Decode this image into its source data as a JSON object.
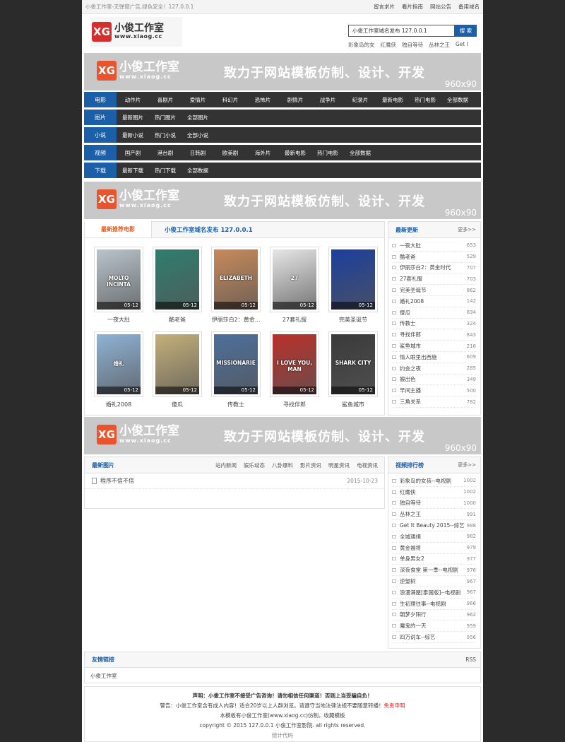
{
  "topbar": {
    "slogan": "小俊工作室-无弹窗广告,绿色安全！127.0.0.1",
    "links": [
      "留言求片",
      "看片指南",
      "网站公告",
      "备用域名"
    ]
  },
  "header": {
    "logo_cn": "小俊工作室",
    "logo_url": "www.xiaog.cc",
    "search_value": "小俊工作室域名发布 127.0.0.1",
    "search_button": "搜 索",
    "hotwords": [
      "彩象岛的女",
      "红鹰侠",
      "独自等待",
      "丛林之王",
      "Get I"
    ]
  },
  "banner": {
    "cn": "小俊工作室",
    "url": "www.xiaog.cc",
    "slogan": "致力于网站模板仿制、设计、开发",
    "size": "960x90"
  },
  "nav": [
    {
      "cat": "电影",
      "items": [
        "动作片",
        "喜剧片",
        "爱情片",
        "科幻片",
        "恐怖片",
        "剧情片",
        "战争片",
        "纪录片",
        "最新电影",
        "热门电影",
        "全部数据"
      ]
    },
    {
      "cat": "图片",
      "items": [
        "最新图片",
        "热门图片",
        "全部图片"
      ]
    },
    {
      "cat": "小说",
      "items": [
        "最新小说",
        "热门小说",
        "全部小说"
      ]
    },
    {
      "cat": "视频",
      "items": [
        "国产剧",
        "港台剧",
        "日韩剧",
        "欧美剧",
        "海外片",
        "最新电影",
        "热门电影",
        "全部数据"
      ]
    },
    {
      "cat": "下载",
      "items": [
        "最新下载",
        "热门下载",
        "全部数据"
      ]
    }
  ],
  "recommend": {
    "tab1": "最新推荐电影",
    "tab2": "小俊工作室域名发布 127.0.0.1",
    "posters": [
      {
        "title": "一夜大肚",
        "date": "05-12",
        "color": "#b8c4cc",
        "text": "MOLTO INCINTA"
      },
      {
        "title": "酷老爸",
        "date": "05-12",
        "color": "#2f7d6e",
        "text": ""
      },
      {
        "title": "伊丽莎白2：黄金...",
        "date": "05-12",
        "color": "#c88a5a",
        "text": "ELIZABETH"
      },
      {
        "title": "27套礼服",
        "date": "05-12",
        "color": "#e6e6e6",
        "text": "27"
      },
      {
        "title": "完美圣诞节",
        "date": "05-12",
        "color": "#1c3f9e",
        "text": ""
      },
      {
        "title": "婚礼2008",
        "date": "05-12",
        "color": "#8fb3d6",
        "text": "婚礼"
      },
      {
        "title": "傻瓜",
        "date": "05-12",
        "color": "#c4b07a",
        "text": ""
      },
      {
        "title": "传教士",
        "date": "05-12",
        "color": "#4d6f9c",
        "text": "MISSIONARIE"
      },
      {
        "title": "寻找伴郎",
        "date": "05-12",
        "color": "#b9302a",
        "text": "I LOVE YOU, MAN"
      },
      {
        "title": "鲨鱼城市",
        "date": "05-12",
        "color": "#3a3a3a",
        "text": "SHARK CITY"
      }
    ]
  },
  "latest": {
    "title": "最新更新",
    "more": "更多>>",
    "items": [
      {
        "name": "一夜大肚",
        "count": "653"
      },
      {
        "name": "酷老爸",
        "count": "529"
      },
      {
        "name": "伊丽莎白2：黄金时代",
        "count": "707"
      },
      {
        "name": "27套礼服",
        "count": "703"
      },
      {
        "name": "完美圣诞节",
        "count": "862"
      },
      {
        "name": "婚礼2008",
        "count": "142"
      },
      {
        "name": "傻瓜",
        "count": "834"
      },
      {
        "name": "传教士",
        "count": "324"
      },
      {
        "name": "寻找伴郎",
        "count": "843"
      },
      {
        "name": "鲨鱼城市",
        "count": "216"
      },
      {
        "name": "情人眼里出西施",
        "count": "609"
      },
      {
        "name": "约会之夜",
        "count": "285"
      },
      {
        "name": "搬出色",
        "count": "349"
      },
      {
        "name": "早间主播",
        "count": "500"
      },
      {
        "name": "三角关系",
        "count": "782"
      }
    ]
  },
  "news": {
    "title": "最新图片",
    "tabs": [
      "站内新闻",
      "娱乐动态",
      "八卦爆料",
      "影片资讯",
      "明星资讯",
      "电视资讯"
    ],
    "items": [
      {
        "title": "程序不信不信",
        "date": "2015-10-23"
      }
    ]
  },
  "ranking": {
    "title": "视频排行榜",
    "more": "更多>>",
    "items": [
      {
        "name": "彩象岛的女孩--电视剧",
        "count": "1002"
      },
      {
        "name": "红鹰侠",
        "count": "1002"
      },
      {
        "name": "独自等待",
        "count": "1000"
      },
      {
        "name": "丛林之王",
        "count": "991"
      },
      {
        "name": "Get It Beauty 2015--综艺",
        "count": "988"
      },
      {
        "name": "全城通缉",
        "count": "982"
      },
      {
        "name": "黄金福将",
        "count": "979"
      },
      {
        "name": "单身男女2",
        "count": "977"
      },
      {
        "name": "深夜食堂 第一季--电视剧",
        "count": "976"
      },
      {
        "name": "逆望树",
        "count": "967"
      },
      {
        "name": "浪漫满屋[泰国版]--电视剧",
        "count": "967"
      },
      {
        "name": "生初理往事--电视剧",
        "count": "966"
      },
      {
        "name": "朝梦夕阳行",
        "count": "962"
      },
      {
        "name": "魔鬼的一天",
        "count": "959"
      },
      {
        "name": "四万说车--综艺",
        "count": "956"
      }
    ]
  },
  "links": {
    "title": "友情链接",
    "rss": "RSS",
    "items": [
      "小俊工作室"
    ]
  },
  "footer": {
    "line1": "声明：小俊工作室不接受广告咨询！请勿相信任何渠道！否则上当受骗自负！",
    "line2": "警告：小俊工作室含有成人内容！适合20岁以上人群浏览。请遵守当地法律法规不要随意转播！",
    "line2_red": "免责申明",
    "line3": "本模板有小俊工作室(www.xiaog.cc)仿制，收藏模板",
    "line4": "copyright © 2015 127.0.0.1 小俊工作室影院. all rights reserved.",
    "line5": "统计代码"
  }
}
